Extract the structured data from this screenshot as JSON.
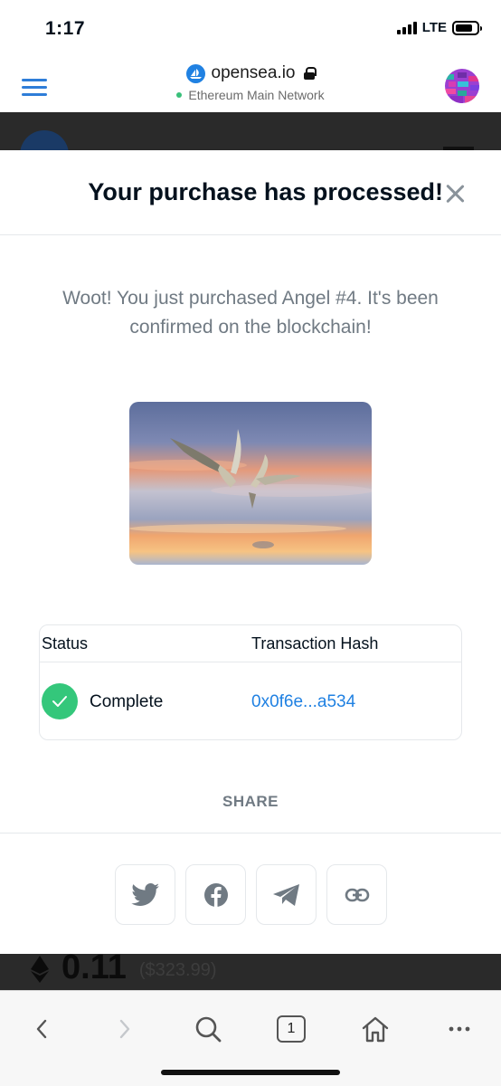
{
  "status_bar": {
    "time": "1:17",
    "carrier": "LTE"
  },
  "browser": {
    "domain": "opensea.io",
    "network": "Ethereum Main Network",
    "network_color": "#39c07a"
  },
  "background_page": {
    "price": "0.11",
    "price_usd": "($323.99)"
  },
  "modal": {
    "title": "Your purchase has processed!",
    "message": "Woot! You just purchased Angel #4. It's been confirmed on the blockchain!",
    "table": {
      "headers": [
        "Status",
        "Transaction Hash"
      ],
      "status": "Complete",
      "hash": "0x0f6e...a534"
    },
    "share_label": "SHARE",
    "share_buttons": [
      "twitter-icon",
      "facebook-icon",
      "telegram-icon",
      "link-icon"
    ]
  },
  "toolbar": {
    "tab_count": "1"
  },
  "colors": {
    "accent": "#2081e2",
    "success": "#34c77b",
    "muted_text": "#707a83"
  }
}
